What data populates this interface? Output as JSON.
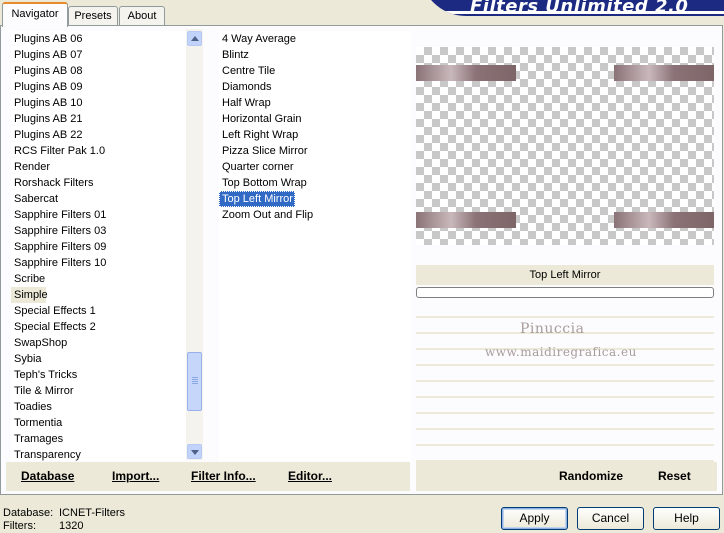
{
  "tabs": [
    "Navigator",
    "Presets",
    "About"
  ],
  "banner_title": "Filters Unlimited 2.0",
  "categories": [
    "Plugins AB 06",
    "Plugins AB 07",
    "Plugins AB 08",
    "Plugins AB 09",
    "Plugins AB 10",
    "Plugins AB 21",
    "Plugins AB 22",
    "RCS Filter Pak 1.0",
    "Render",
    "Rorshack Filters",
    "Sabercat",
    "Sapphire Filters 01",
    "Sapphire Filters 03",
    "Sapphire Filters 09",
    "Sapphire Filters 10",
    "Scribe",
    "Simple",
    "Special Effects 1",
    "Special Effects 2",
    "SwapShop",
    "Sybia",
    "Teph's Tricks",
    "Tile & Mirror",
    "Toadies",
    "Tormentia",
    "Tramages",
    "Transparency"
  ],
  "selected_category": "Simple",
  "filters": [
    "4 Way Average",
    "Blintz",
    "Centre Tile",
    "Diamonds",
    "Half Wrap",
    "Horizontal Grain",
    "Left Right Wrap",
    "Pizza Slice Mirror",
    "Quarter corner",
    "Top Bottom Wrap",
    "Top Left Mirror",
    "Zoom Out and Flip"
  ],
  "selected_filter": "Top Left Mirror",
  "left_buttons": {
    "database": "Database",
    "import": "Import...",
    "filter_info": "Filter Info...",
    "editor": "Editor..."
  },
  "right_buttons": {
    "randomize": "Randomize",
    "reset": "Reset"
  },
  "preview_label": "Top Left Mirror",
  "watermark": {
    "line1": "Pinuccia",
    "line2": "www.maidiregrafica.eu"
  },
  "status": {
    "database_label": "Database:",
    "database_value": "ICNET-Filters",
    "filters_label": "Filters:",
    "filters_value": "1320"
  },
  "dialog_buttons": {
    "apply": "Apply",
    "cancel": "Cancel",
    "help": "Help"
  },
  "colors": {
    "selection": "#316ac5",
    "banner": "#1c2a82",
    "background": "#ece9d8"
  },
  "scrollbar_position": 0.78
}
